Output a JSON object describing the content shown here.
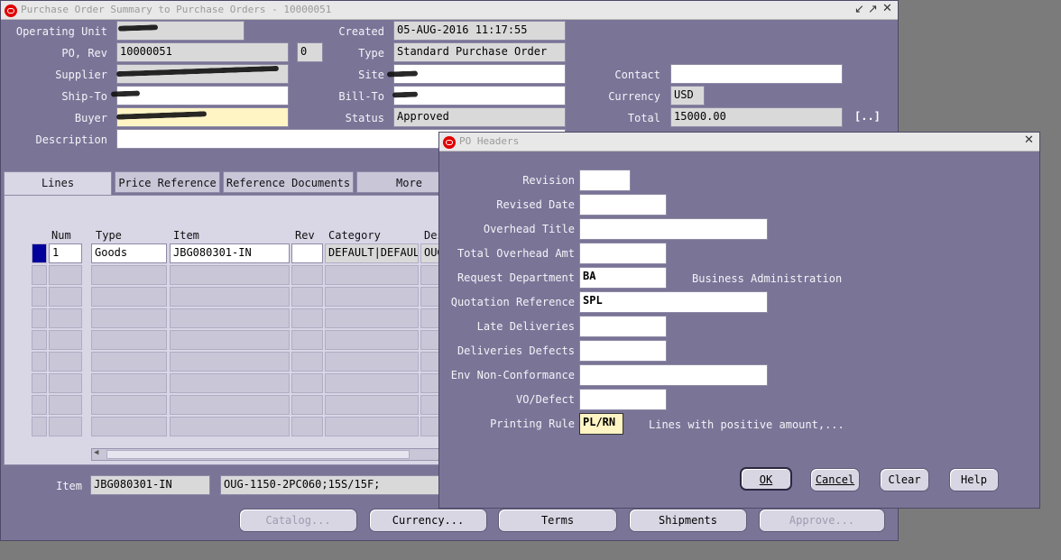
{
  "main": {
    "title": "Purchase Order Summary to Purchase Orders - 10000051",
    "labels": {
      "operating_unit": "Operating Unit",
      "po_rev": "PO, Rev",
      "supplier": "Supplier",
      "ship_to": "Ship-To",
      "buyer": "Buyer",
      "description": "Description",
      "created": "Created",
      "type": "Type",
      "site": "Site",
      "bill_to": "Bill-To",
      "status": "Status",
      "contact": "Contact",
      "currency": "Currency",
      "total": "Total"
    },
    "values": {
      "operating_unit": "",
      "po_number": "10000051",
      "rev": "0",
      "supplier": "",
      "ship_to": "",
      "buyer": "",
      "description": "",
      "created": "05-AUG-2016 11:17:55",
      "type": "Standard Purchase Order",
      "site": "",
      "bill_to": "",
      "status": "Approved",
      "contact": "",
      "currency": "USD",
      "total": "15000.00",
      "total_button": "[..]"
    },
    "tabs": [
      "Lines",
      "Price Reference",
      "Reference Documents",
      "More"
    ],
    "columns": [
      "Num",
      "Type",
      "Item",
      "Rev",
      "Category",
      "Des"
    ],
    "row1": {
      "num": "1",
      "type": "Goods",
      "item": "JBG080301-IN",
      "rev": "",
      "category": "DEFAULT|DEFAULT",
      "description": "OUG"
    },
    "footer": {
      "item_label": "Item",
      "item_value": "JBG080301-IN",
      "item_desc": "OUG-1150-2PC060;15S/15F;"
    },
    "buttons": {
      "catalog": "Catalog...",
      "currency": "Currency...",
      "terms": "Terms",
      "shipments": "Shipments",
      "approve": "Approve..."
    }
  },
  "dialog": {
    "title": "PO Headers",
    "labels": {
      "revision": "Revision",
      "revised_date": "Revised Date",
      "overhead_title": "Overhead Title",
      "total_overhead_amt": "Total Overhead Amt",
      "request_department": "Request Department",
      "quotation_reference": "Quotation Reference",
      "late_deliveries": "Late Deliveries",
      "deliveries_defects": "Deliveries Defects",
      "env_non_conformance": "Env Non-Conformance",
      "vo_defect": "VO/Defect",
      "printing_rule": "Printing Rule"
    },
    "values": {
      "revision": "",
      "revised_date": "",
      "overhead_title": "",
      "total_overhead_amt": "",
      "request_department": "BA",
      "request_department_desc": "Business Administration",
      "quotation_reference": "SPL",
      "late_deliveries": "",
      "deliveries_defects": "",
      "env_non_conformance": "",
      "vo_defect": "",
      "printing_rule": "PL/RN",
      "printing_rule_desc": "Lines with positive amount,..."
    },
    "buttons": {
      "ok": "OK",
      "cancel": "Cancel",
      "clear": "Clear",
      "help": "Help"
    }
  },
  "icons": [
    "oracle-logo-icon",
    "minimize-icon",
    "maximize-icon",
    "close-icon"
  ],
  "colors": {
    "window_bg": "#7a7497",
    "required_field": "#fff4c4",
    "selected_row": "#00009a"
  }
}
